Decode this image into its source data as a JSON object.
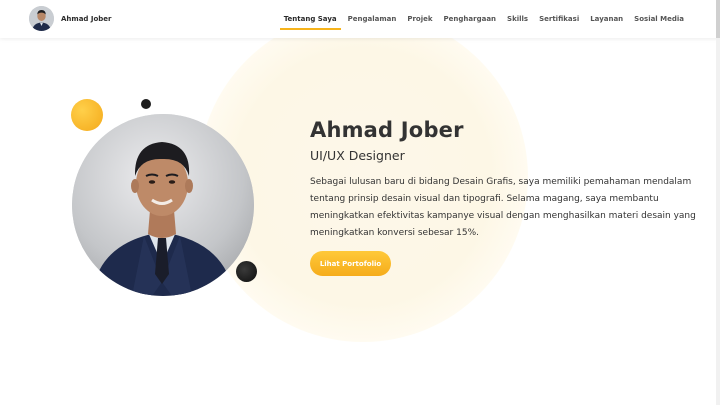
{
  "brand": {
    "name": "Ahmad Jober"
  },
  "nav": {
    "items": [
      {
        "label": "Tentang Saya",
        "active": true
      },
      {
        "label": "Pengalaman"
      },
      {
        "label": "Projek"
      },
      {
        "label": "Penghargaan"
      },
      {
        "label": "Skills"
      },
      {
        "label": "Sertifikasi"
      },
      {
        "label": "Layanan"
      },
      {
        "label": "Sosial Media"
      }
    ]
  },
  "hero": {
    "name": "Ahmad Jober",
    "role": "UI/UX Designer",
    "bio": "Sebagai lulusan baru di bidang Desain Grafis, saya memiliki pemahaman mendalam tentang prinsip desain visual dan tipografi. Selama magang, saya membantu meningkatkan efektivitas kampanye visual dengan menghasilkan materi desain yang meningkatkan konversi sebesar 15%.",
    "cta_label": "Lihat Portofolio"
  },
  "colors": {
    "accent": "#f6b31b",
    "text": "#2b2b2b",
    "glow": "#fdf7e6"
  },
  "icons": {
    "profile": "profile-photo"
  }
}
